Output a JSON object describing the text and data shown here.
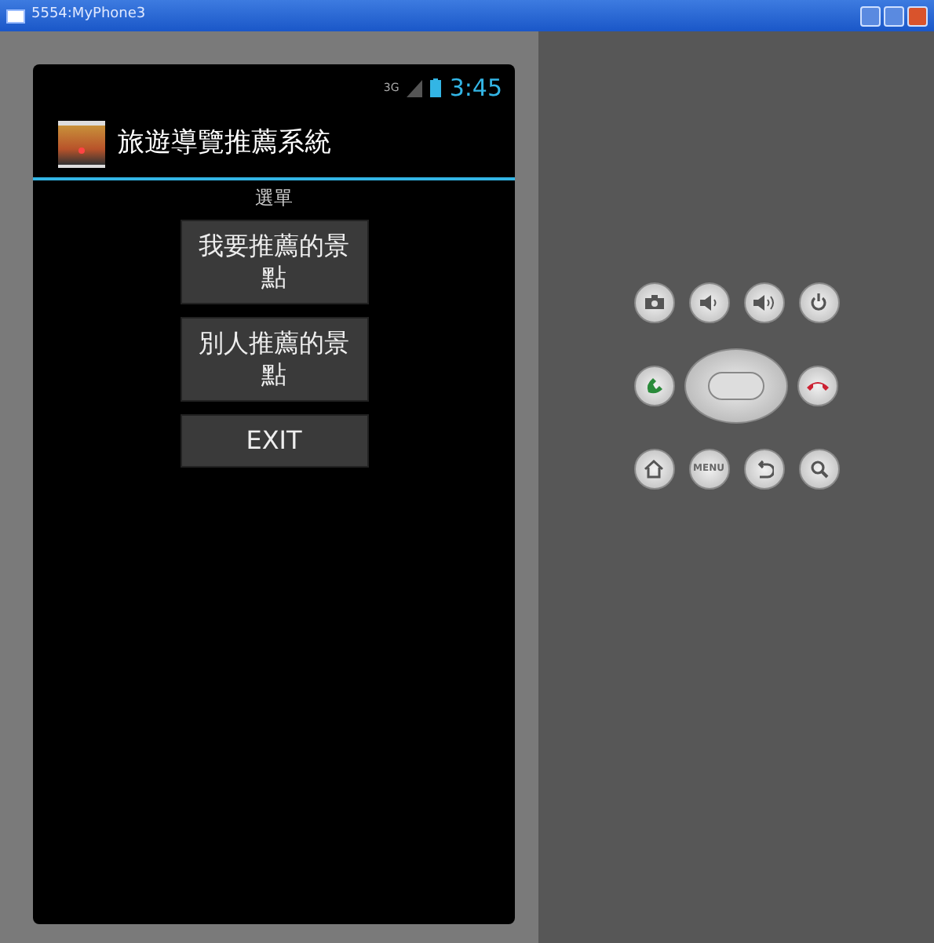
{
  "window": {
    "title": "5554:MyPhone3"
  },
  "status_bar": {
    "network": "3G",
    "time": "3:45"
  },
  "action_bar": {
    "title": "旅遊導覽推薦系統"
  },
  "menu": {
    "label": "選單",
    "buttons": [
      "我要推薦的景點",
      "別人推薦的景點",
      "EXIT"
    ]
  },
  "keypad": {
    "menu_key": "MENU"
  }
}
